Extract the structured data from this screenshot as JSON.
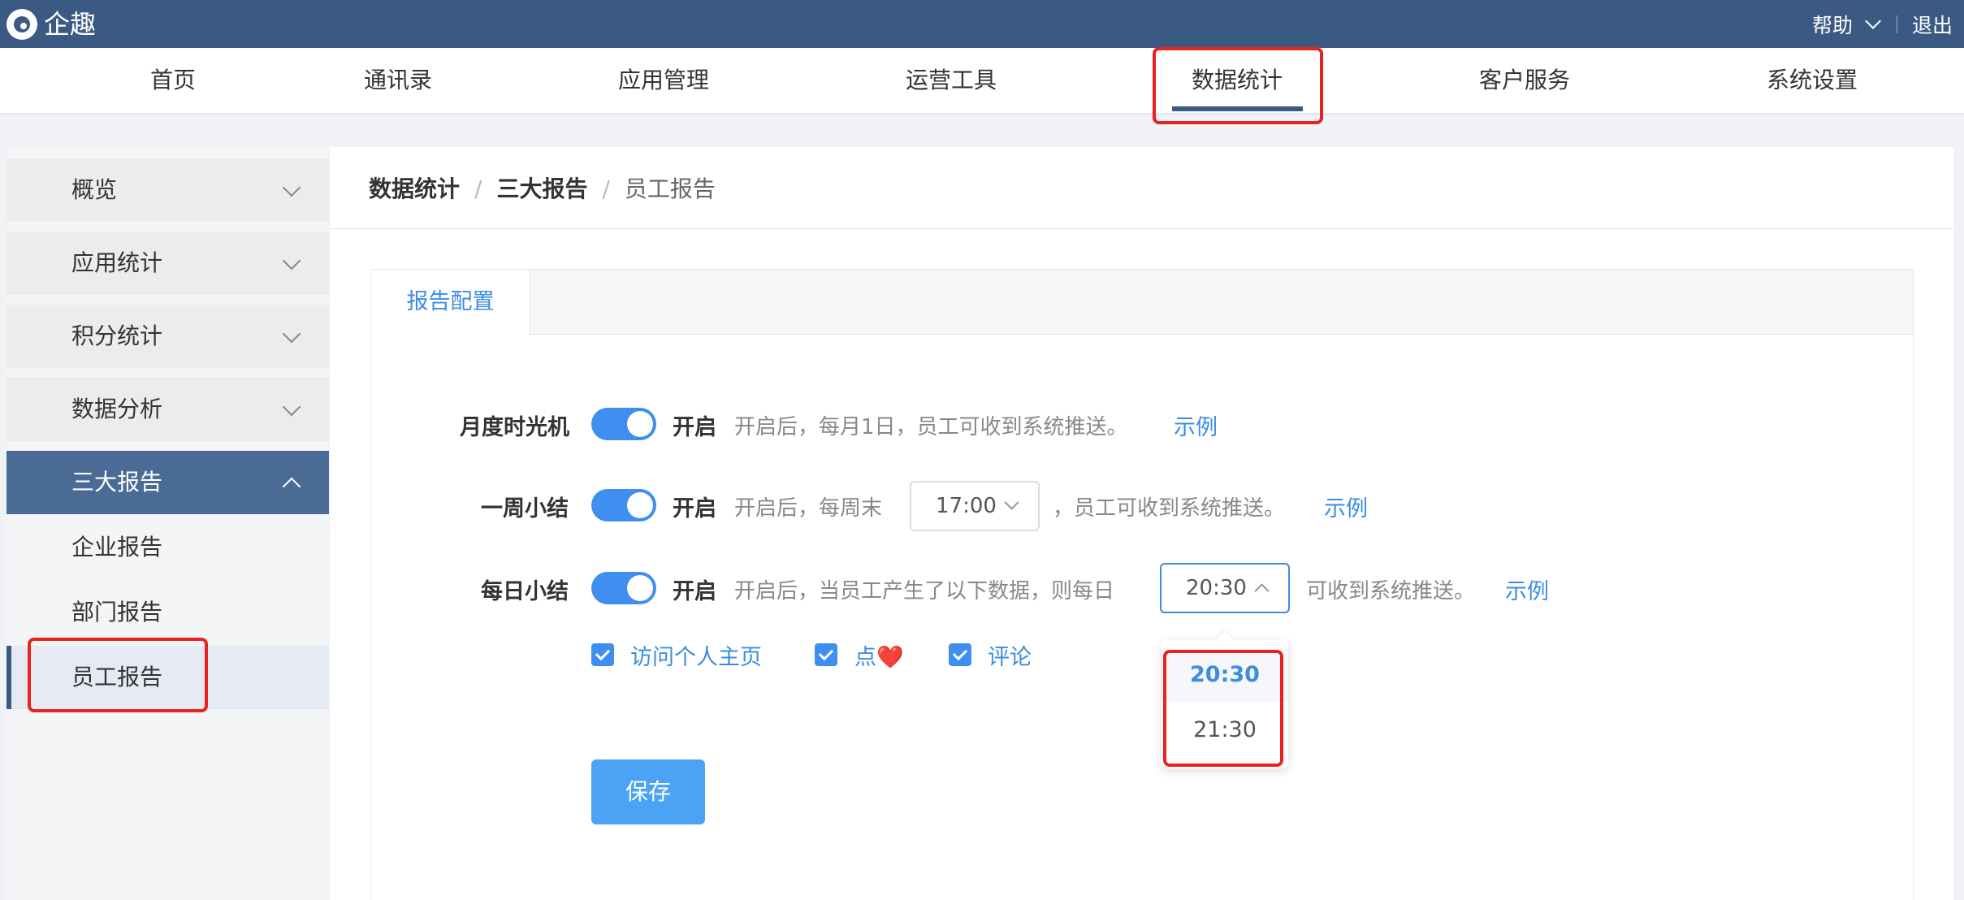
{
  "topbar": {
    "brand": "企趣",
    "help": "帮助",
    "logout": "退出"
  },
  "nav": {
    "items": [
      "首页",
      "通讯录",
      "应用管理",
      "运营工具",
      "数据统计",
      "客户服务",
      "系统设置"
    ],
    "active": "数据统计"
  },
  "sidebar": {
    "groups": [
      "概览",
      "应用统计",
      "积分统计",
      "数据分析"
    ],
    "open_group": "三大报告",
    "sub_items": [
      "企业报告",
      "部门报告",
      "员工报告"
    ],
    "active_sub": "员工报告"
  },
  "breadcrumb": [
    "数据统计",
    "三大报告",
    "员工报告"
  ],
  "tab": "报告配置",
  "monthly": {
    "label": "月度时光机",
    "toggle_on": true,
    "status": "开启",
    "desc": "开启后，每月1日，员工可收到系统推送。",
    "link": "示例"
  },
  "weekly": {
    "label": "一周小结",
    "toggle_on": true,
    "status": "开启",
    "desc_before": "开启后，每周末",
    "time": "17:00",
    "desc_after": "，员工可收到系统推送。",
    "link": "示例"
  },
  "daily": {
    "label": "每日小结",
    "toggle_on": true,
    "status": "开启",
    "desc_before": "开启后，当员工产生了以下数据，则每日",
    "time": "20:30",
    "desc_after": "可收到系统推送。",
    "link": "示例",
    "checkboxes": [
      "访问个人主页",
      "点❤️",
      "评论"
    ],
    "options": [
      "20:30",
      "21:30"
    ],
    "selected_option": "20:30"
  },
  "save_label": "保存",
  "colors": {
    "topbar": "#3b5a83",
    "accent": "#3f8ef0",
    "highlight": "#e8231f"
  }
}
